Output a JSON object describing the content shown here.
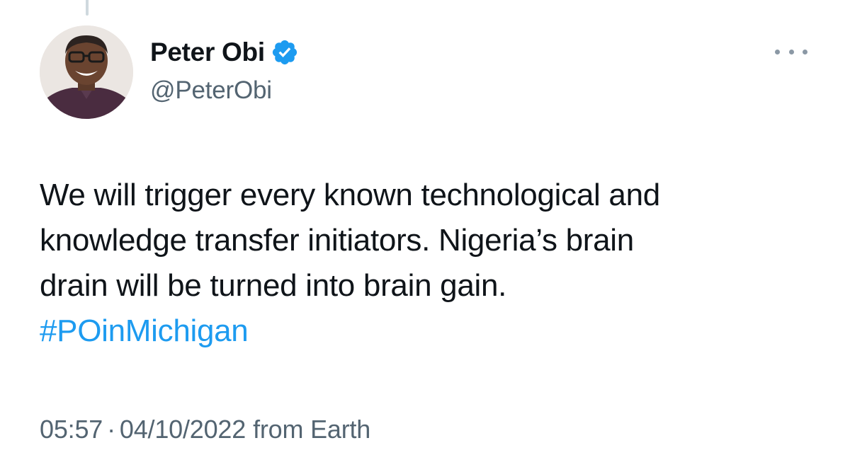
{
  "author": {
    "display_name": "Peter Obi",
    "handle": "@PeterObi",
    "verified": true
  },
  "tweet": {
    "text_lines": [
      "We will trigger every known technological and",
      "knowledge transfer initiators. Nigeria’s brain",
      "drain will be turned into brain gain."
    ],
    "hashtag": "#POinMichigan"
  },
  "meta": {
    "time": "05:57",
    "separator": "·",
    "date": "04/10/2022",
    "source": "from Earth"
  },
  "icons": {
    "verified": "verified-badge-icon",
    "more": "more-options-icon"
  },
  "colors": {
    "verified_blue": "#1d9bf0",
    "hashtag_blue": "#1d9bf0",
    "secondary_text": "#536471",
    "primary_text": "#0f1419"
  }
}
